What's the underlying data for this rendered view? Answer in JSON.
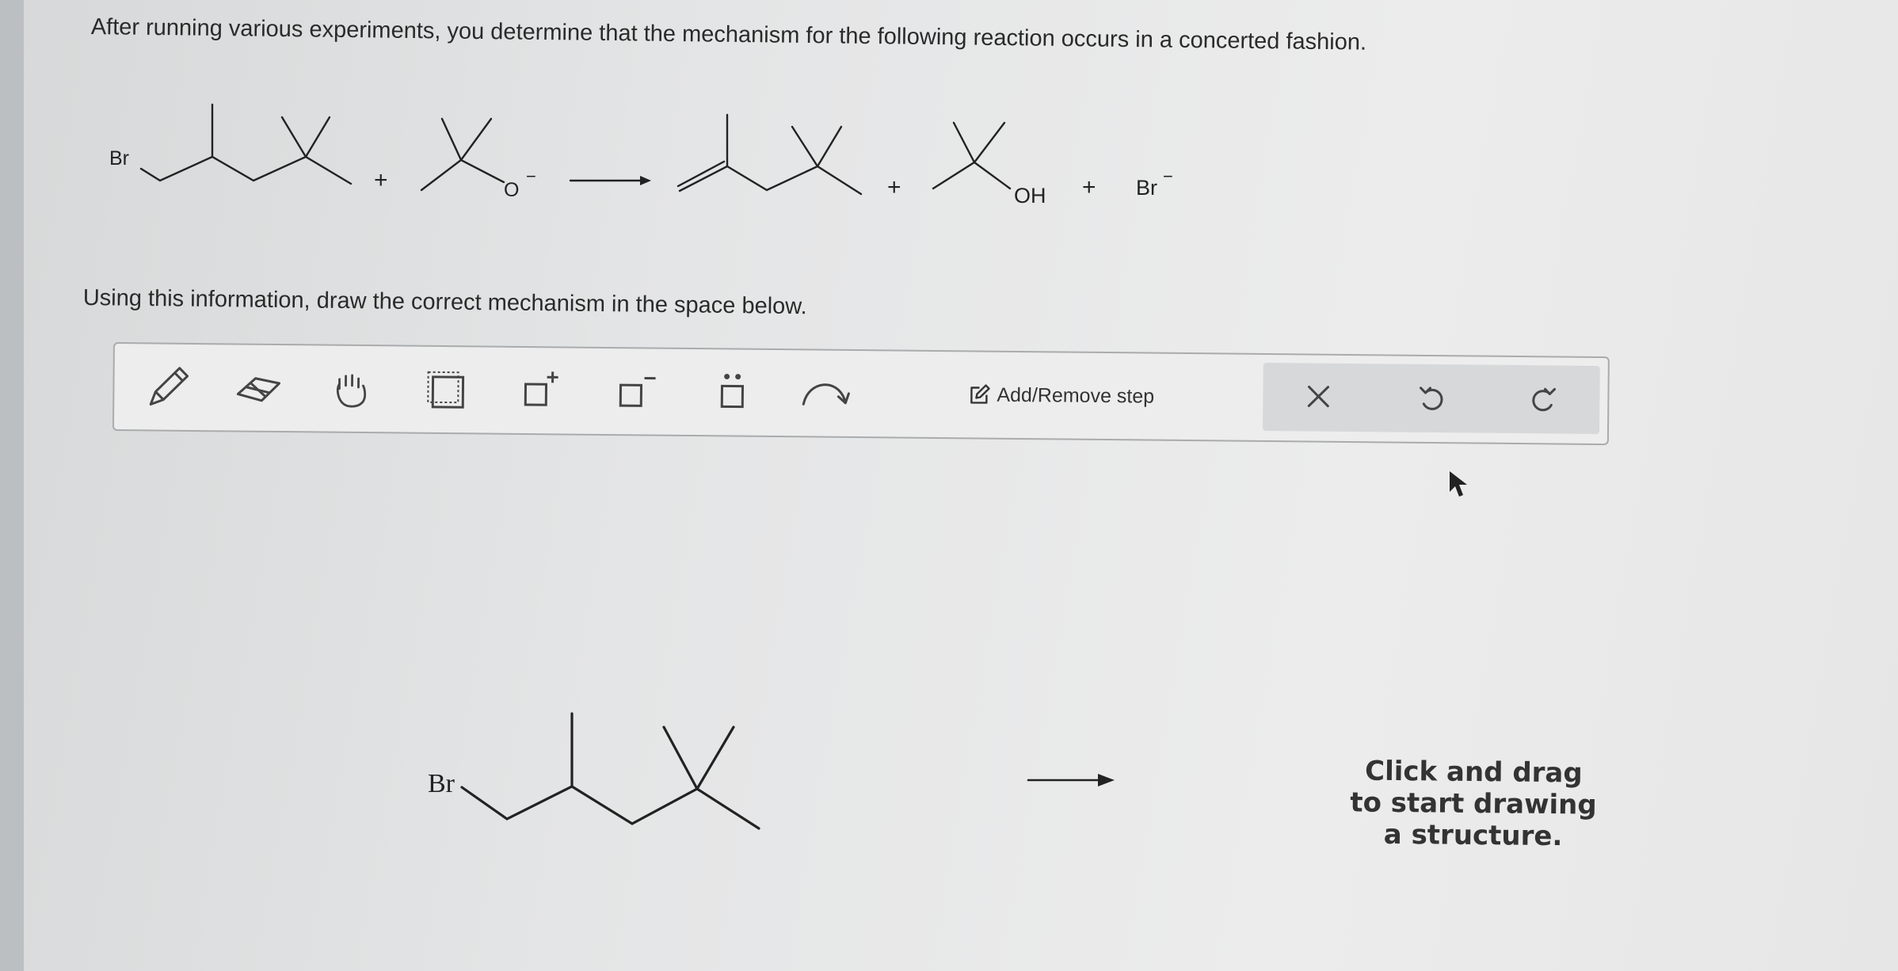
{
  "question": {
    "intro": "After running various experiments, you determine that the mechanism for the following reaction occurs in a concerted fashion.",
    "instruction": "Using this information, draw the correct mechanism in the space below."
  },
  "reaction": {
    "reactant1_label": "Br",
    "plus_1": "+",
    "reactant2_label": "O",
    "reactant2_charge": "−",
    "product2_label": "OH",
    "plus_2": "+",
    "plus_3": "+",
    "product3_label": "Br",
    "product3_charge": "−",
    "plus_small": "+"
  },
  "toolbar": {
    "tools": [
      "pencil-tool",
      "eraser-tool",
      "hand-tool",
      "select-tool",
      "positive-charge-tool",
      "negative-charge-tool",
      "lone-pair-tool",
      "curved-arrow-tool"
    ],
    "add_remove_step_label": "Add/Remove step",
    "actions": [
      "clear",
      "undo",
      "redo"
    ]
  },
  "canvas": {
    "start_label": "Br",
    "prompt": "Click and drag to start drawing a structure."
  }
}
